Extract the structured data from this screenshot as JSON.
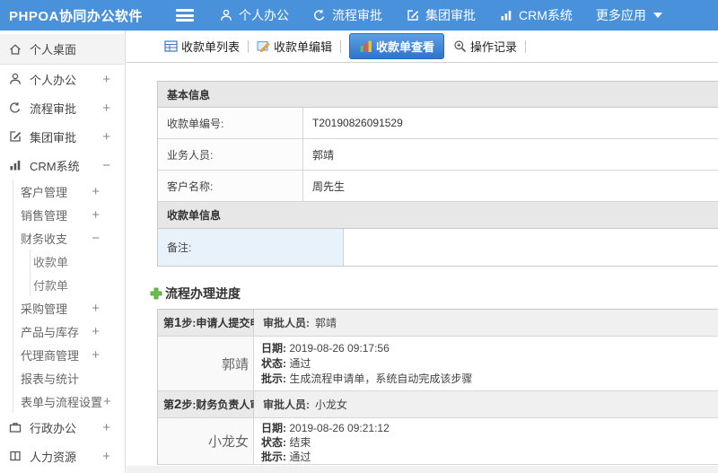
{
  "app": {
    "title": "PHPOA协同办公软件"
  },
  "top_nav": {
    "items": [
      {
        "label": "个人办公"
      },
      {
        "label": "流程审批"
      },
      {
        "label": "集团审批"
      },
      {
        "label": "CRM系统"
      },
      {
        "label": "更多应用"
      }
    ]
  },
  "sidebar": {
    "items": [
      {
        "label": "个人桌面"
      },
      {
        "label": "个人办公",
        "toggle": "+"
      },
      {
        "label": "流程审批",
        "toggle": "+"
      },
      {
        "label": "集团审批",
        "toggle": "+"
      },
      {
        "label": "CRM系统",
        "toggle": "−"
      },
      {
        "label": "客户管理",
        "toggle": "+"
      },
      {
        "label": "销售管理",
        "toggle": "+"
      },
      {
        "label": "财务收支",
        "toggle": "−"
      },
      {
        "label": "收款单"
      },
      {
        "label": "付款单"
      },
      {
        "label": "采购管理",
        "toggle": "+"
      },
      {
        "label": "产品与库存",
        "toggle": "+"
      },
      {
        "label": "代理商管理",
        "toggle": "+"
      },
      {
        "label": "报表与统计"
      },
      {
        "label": "表单与流程设置",
        "toggle": "+"
      },
      {
        "label": "行政办公",
        "toggle": "+"
      },
      {
        "label": "人力资源",
        "toggle": "+"
      }
    ]
  },
  "tabs": {
    "list": "收款单列表",
    "edit": "收款单编辑",
    "view": "收款单查看",
    "log": "操作记录"
  },
  "form": {
    "section1_title": "基本信息",
    "rows": [
      {
        "label": "收款单编号:",
        "value": "T20190826091529"
      },
      {
        "label": "业务人员:",
        "value": "郭靖"
      },
      {
        "label": "客户名称:",
        "value": "周先生"
      }
    ],
    "section2_title": "收款单信息",
    "remark_label": "备注:",
    "remark_value": ""
  },
  "progress": {
    "title": "流程办理进度",
    "steps": [
      {
        "step_prefix": "第",
        "step_num": "1",
        "step_suffix": "步:申请人提交申请",
        "approver_label": "审批人员:",
        "approver": "郭靖",
        "name": "郭靖",
        "date_label": "日期:",
        "date": "2019-08-26 09:17:56",
        "status_label": "状态:",
        "status": "通过",
        "comment_label": "批示:",
        "comment": "生成流程申请单，系统自动完成该步骤"
      },
      {
        "step_prefix": "第",
        "step_num": "2",
        "step_suffix": "步:财务负责人审批",
        "approver_label": "审批人员:",
        "approver": "小龙女",
        "name": "小龙女",
        "date_label": "日期:",
        "date": "2019-08-26 09:21:12",
        "status_label": "状态:",
        "status": "结束",
        "comment_label": "批示:",
        "comment": "通过"
      }
    ]
  }
}
